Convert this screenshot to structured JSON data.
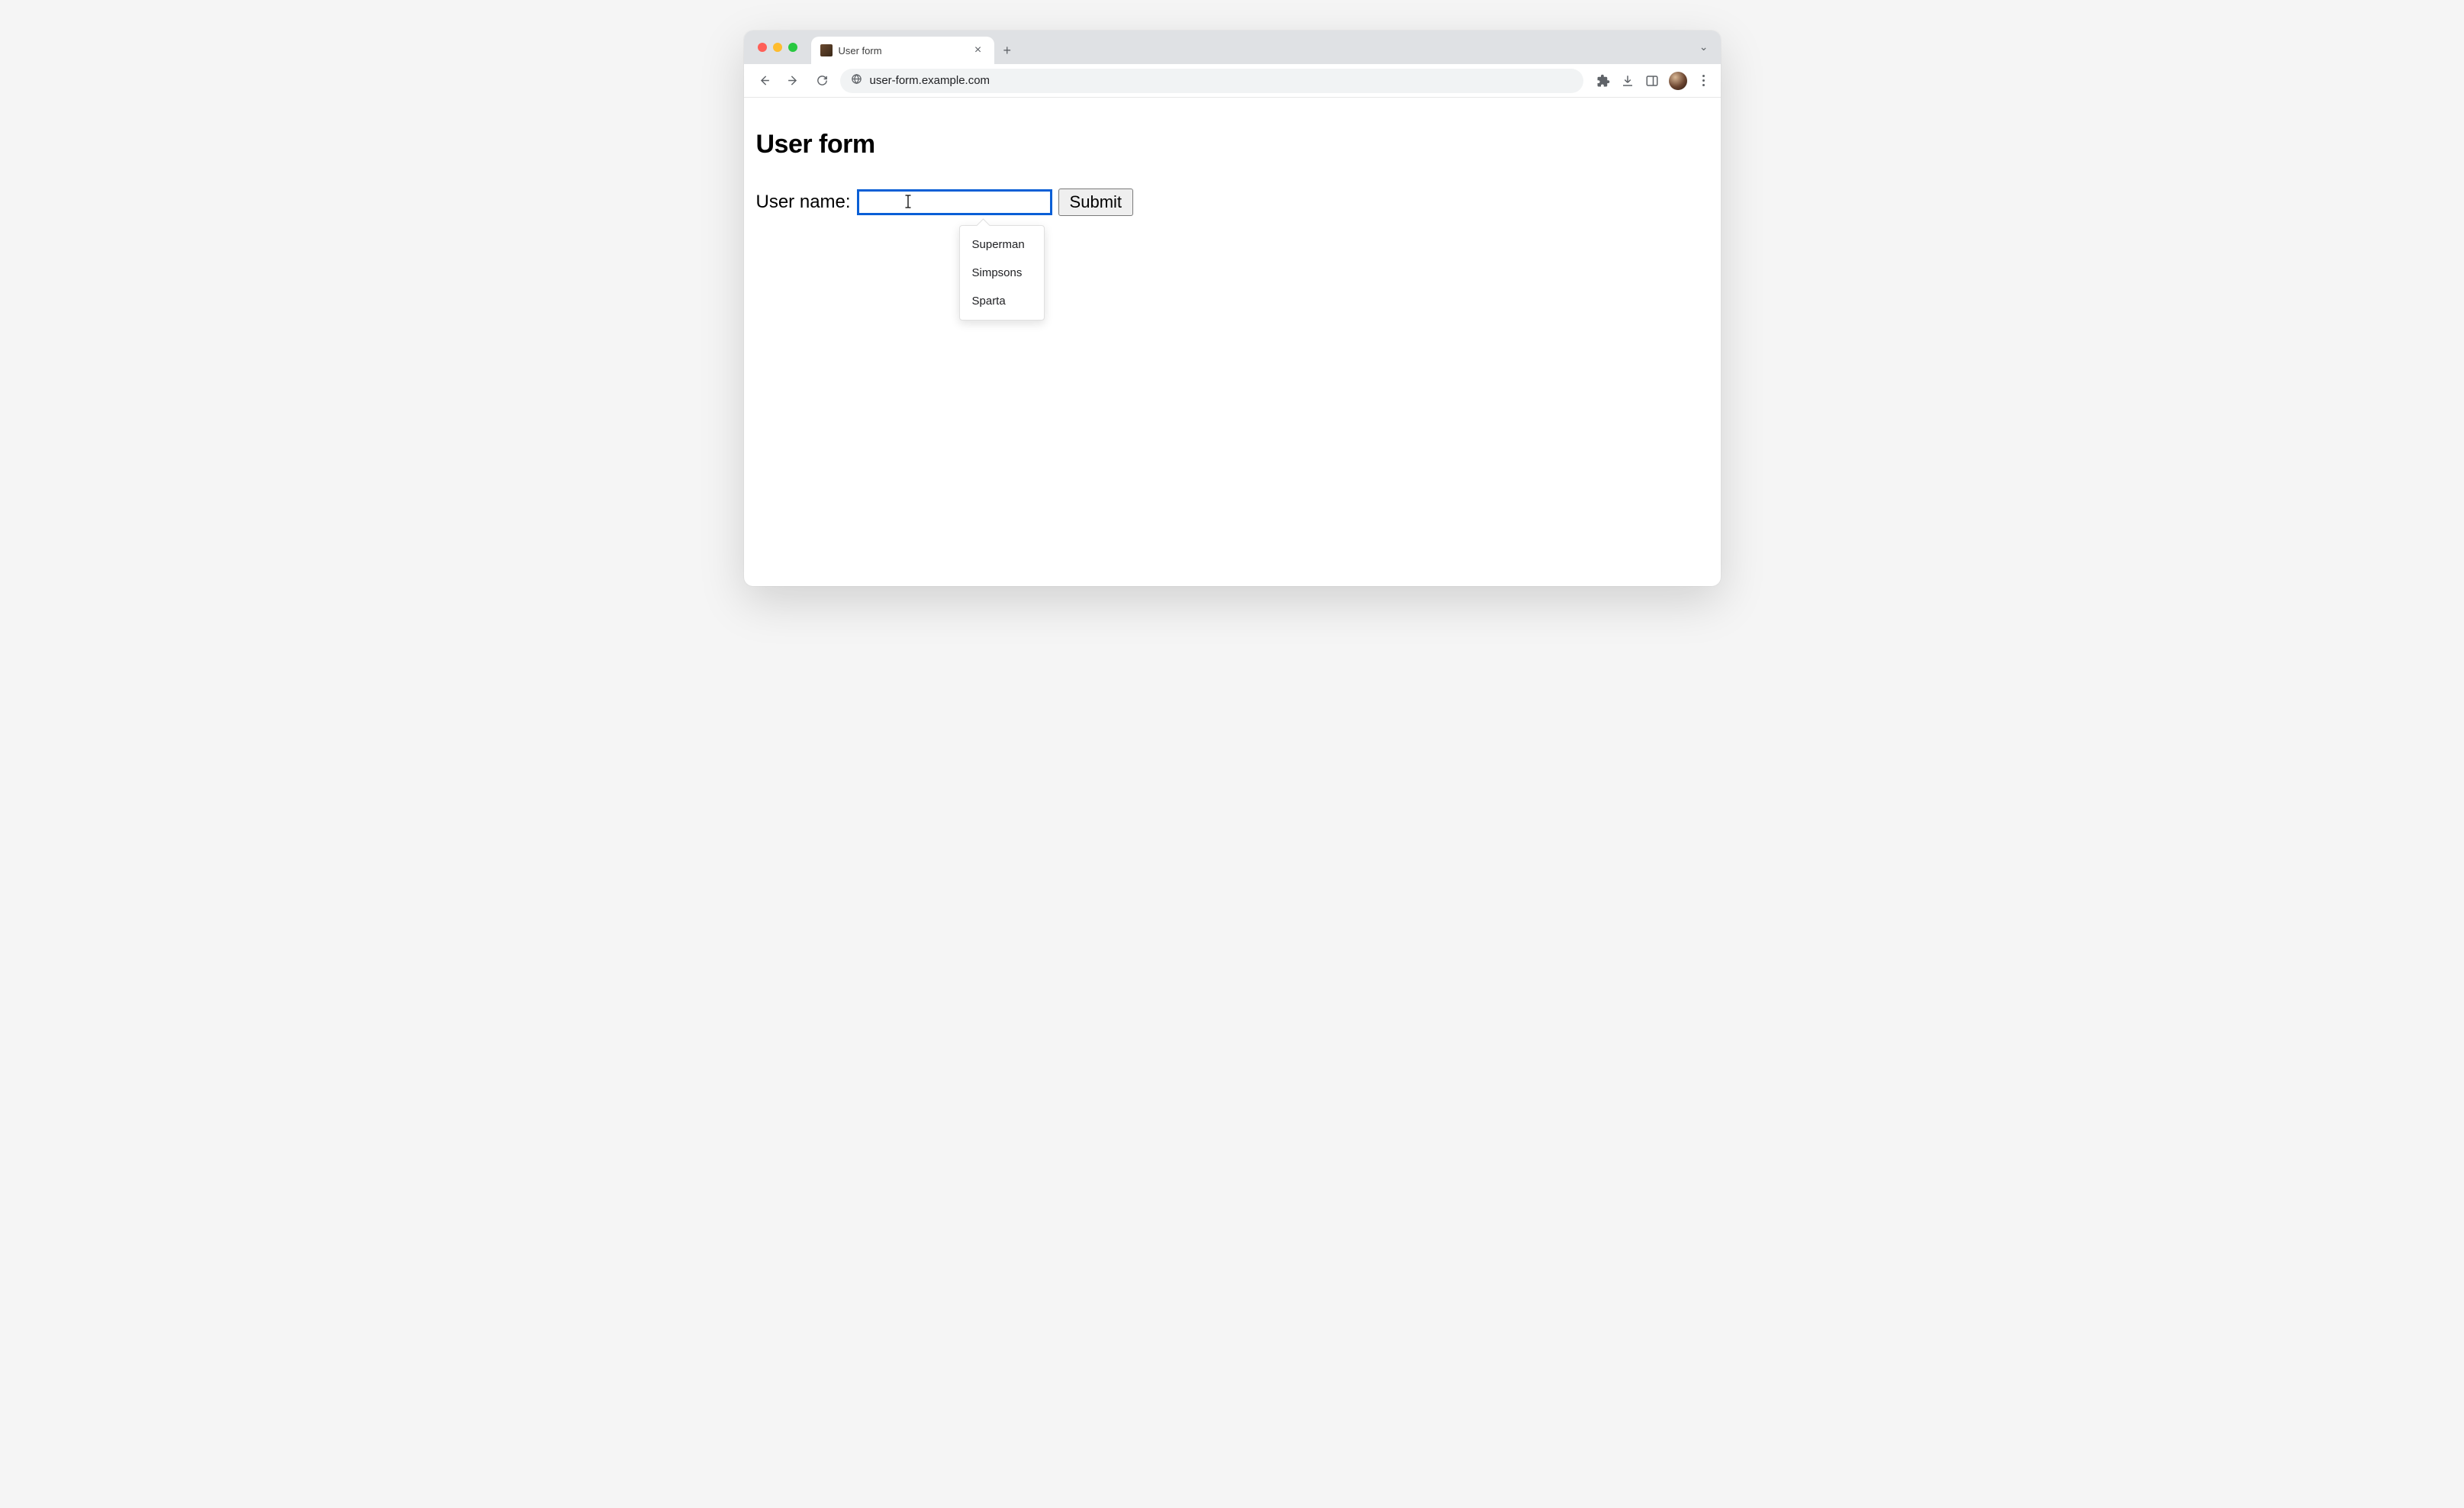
{
  "browser": {
    "tab_title": "User form",
    "url": "user-form.example.com"
  },
  "page": {
    "heading": "User form",
    "form": {
      "label": "User name:",
      "input_value": "",
      "submit_label": "Submit"
    },
    "autocomplete": {
      "items": [
        "Superman",
        "Simpsons",
        "Sparta"
      ]
    }
  }
}
